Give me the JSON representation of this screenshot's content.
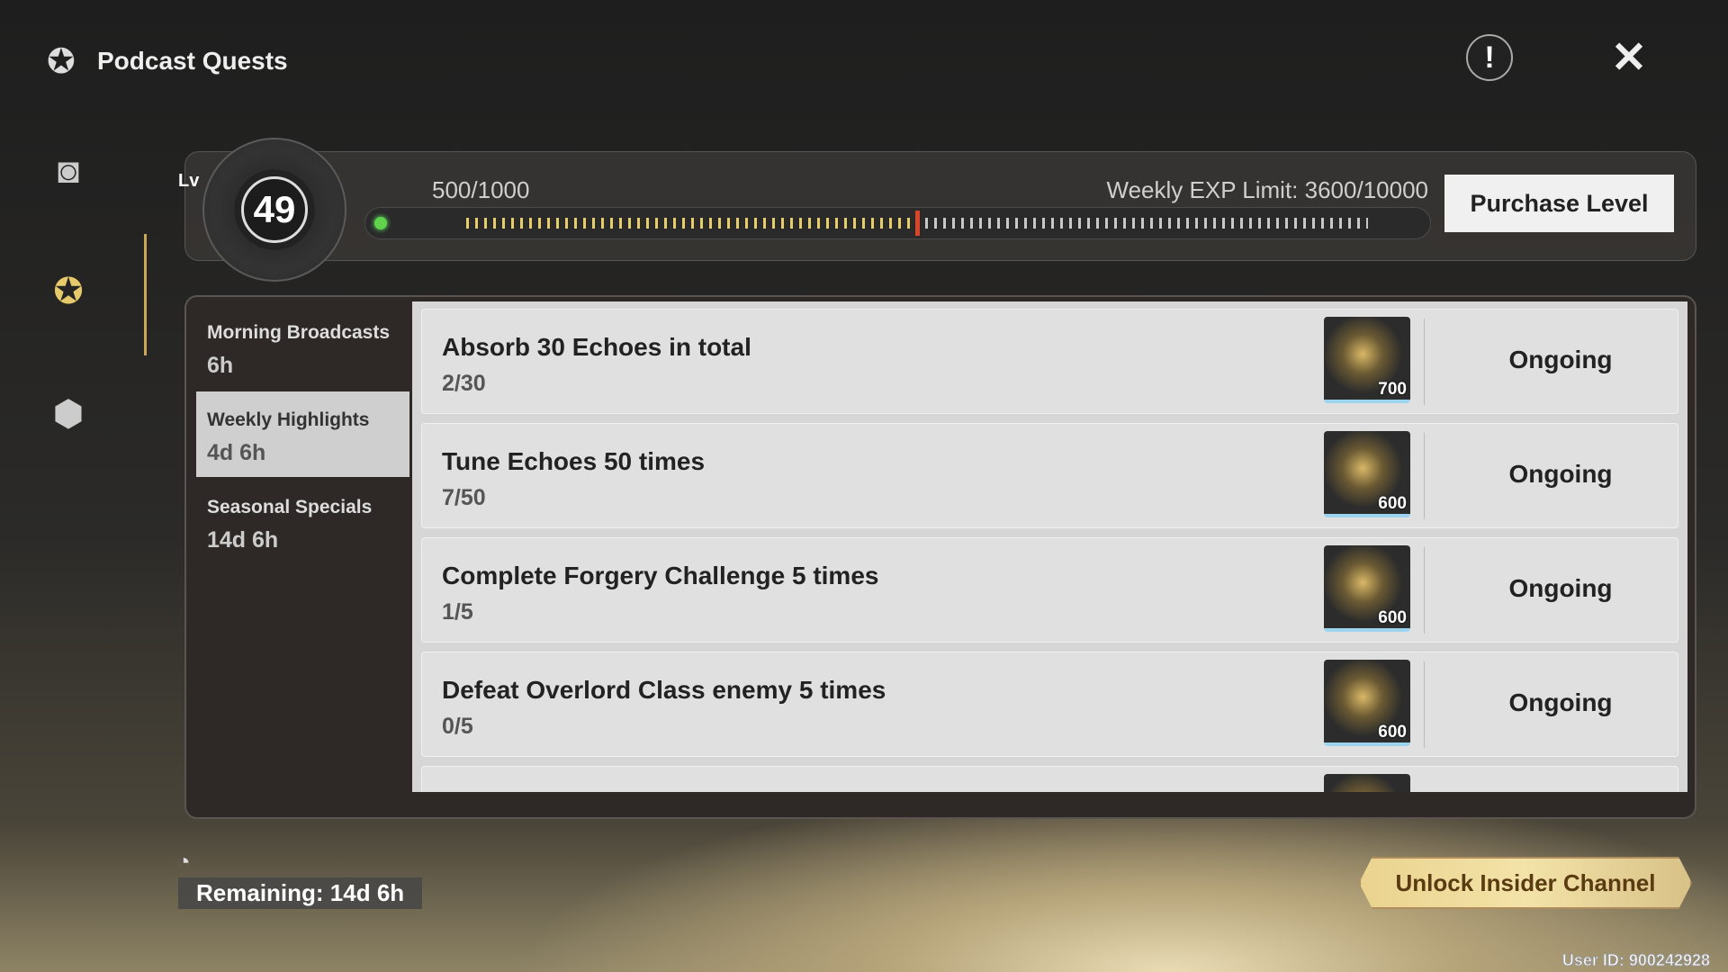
{
  "header": {
    "title": "Podcast Quests",
    "info_icon": "exclamation-icon",
    "close_icon": "close-x-icon"
  },
  "sidebar": {
    "items": [
      {
        "icon": "record-player-icon"
      },
      {
        "icon": "podcast-orb-icon",
        "active": true
      },
      {
        "icon": "box-icon"
      }
    ]
  },
  "level": {
    "label": "Lv",
    "value": "49",
    "exp": "500/1000",
    "exp_progress": 0.5,
    "weekly_limit": "Weekly EXP Limit: 3600/10000",
    "purchase_label": "Purchase Level"
  },
  "tabs": [
    {
      "name": "Morning Broadcasts",
      "time": "6h"
    },
    {
      "name": "Weekly Highlights",
      "time": "4d 6h",
      "active": true
    },
    {
      "name": "Seasonal Specials",
      "time": "14d 6h"
    }
  ],
  "quests": [
    {
      "title": "Absorb 30 Echoes in total",
      "progress": "2/30",
      "reward": "700",
      "status": "Ongoing"
    },
    {
      "title": "Tune Echoes 50 times",
      "progress": "7/50",
      "reward": "600",
      "status": "Ongoing"
    },
    {
      "title": "Complete Forgery Challenge 5 times",
      "progress": "1/5",
      "reward": "600",
      "status": "Ongoing"
    },
    {
      "title": "Defeat Overlord Class enemy 5 times",
      "progress": "0/5",
      "reward": "600",
      "status": "Ongoing"
    }
  ],
  "footer": {
    "remaining": "Remaining: 14d 6h",
    "unlock_label": "Unlock Insider Channel",
    "user_id": "User ID: 900242928"
  },
  "colors": {
    "accent_gold": "#c9a85a",
    "progress_on": "#e6cf6a",
    "marker": "#d9452b"
  }
}
